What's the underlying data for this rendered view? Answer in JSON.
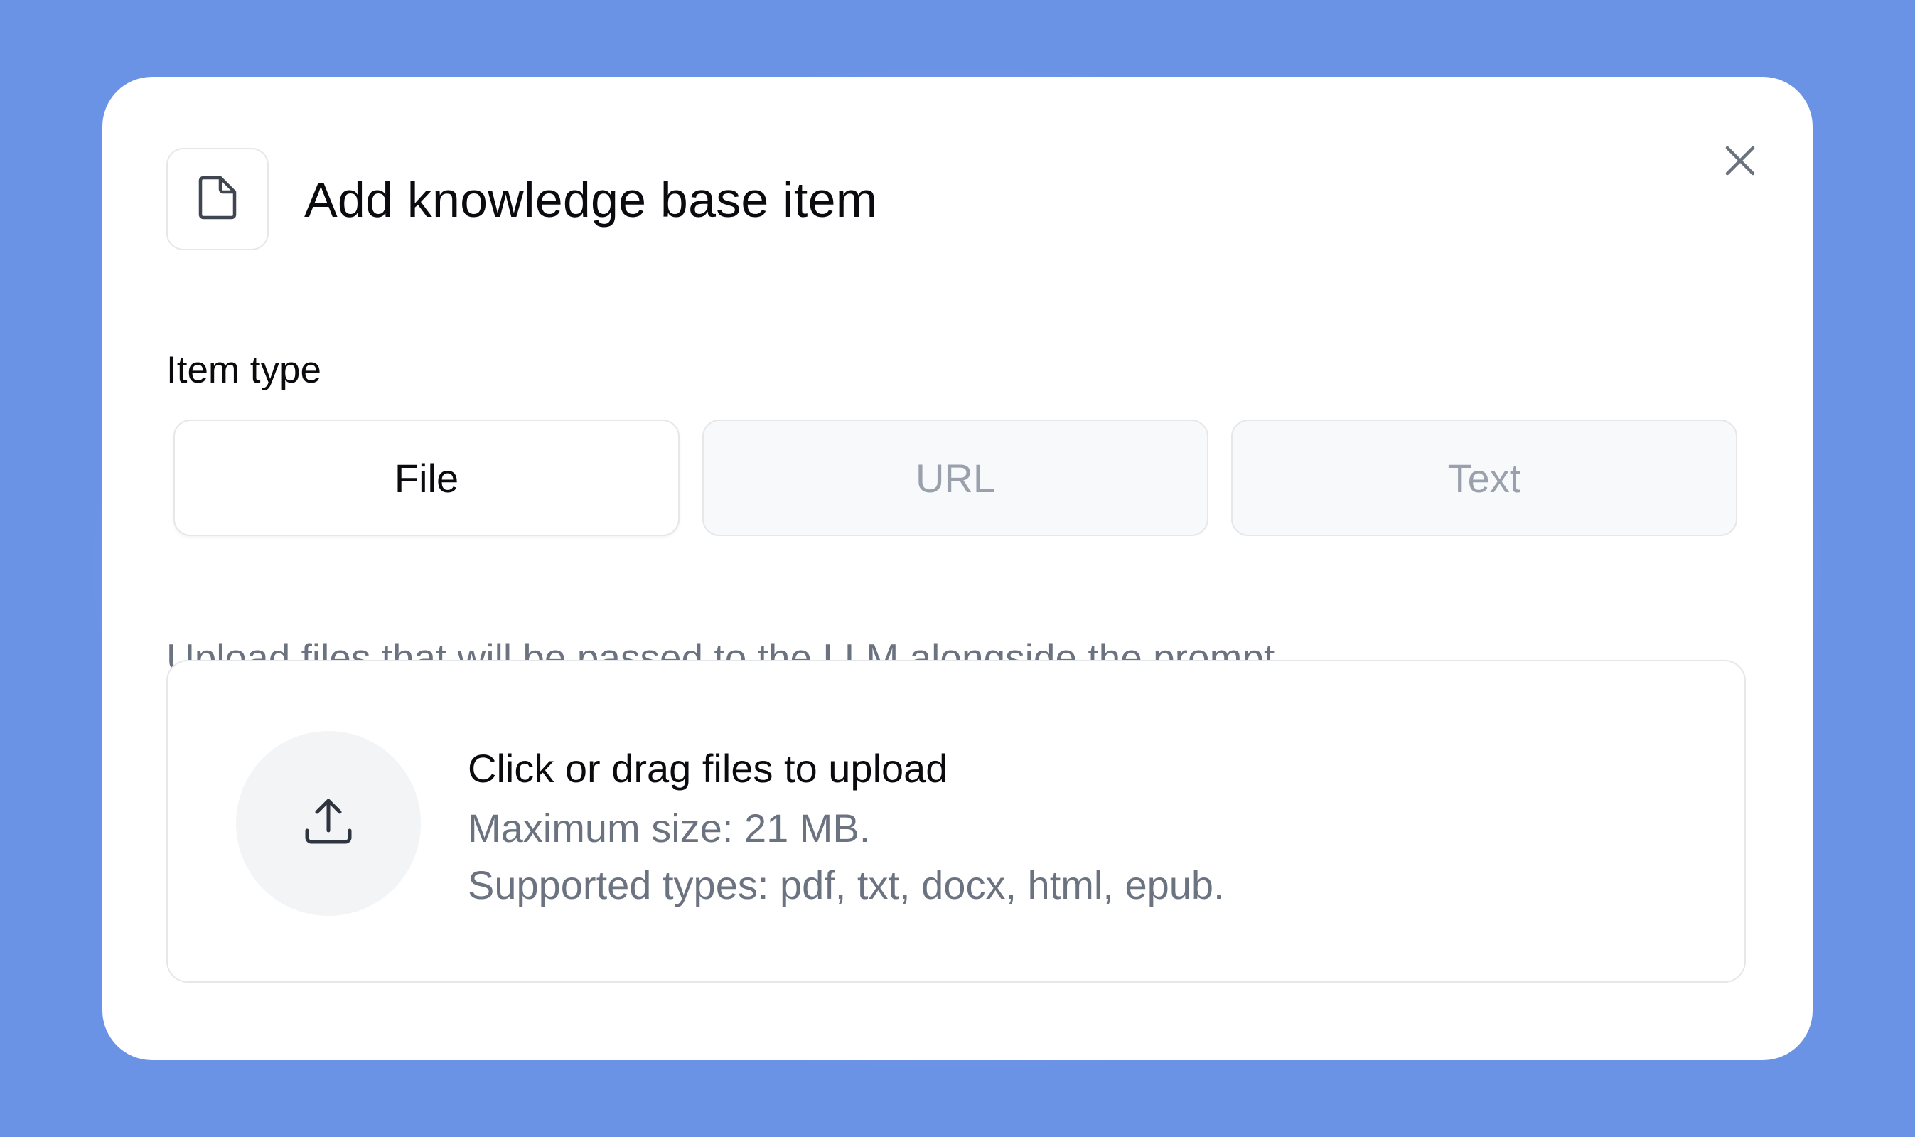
{
  "dialog": {
    "title": "Add knowledge base item",
    "header_icon": "file-icon",
    "close_icon": "close-icon"
  },
  "item_type": {
    "label": "Item type",
    "options": [
      {
        "label": "File",
        "selected": true
      },
      {
        "label": "URL",
        "selected": false
      },
      {
        "label": "Text",
        "selected": false
      }
    ],
    "helper_text": "Upload files that will be passed to the LLM alongside the prompt."
  },
  "upload": {
    "icon": "upload-icon",
    "title": "Click or drag files to upload",
    "max_size": "Maximum size: 21 MB.",
    "supported_types": "Supported types: pdf, txt, docx, html, epub."
  },
  "colors": {
    "background": "#6a93e6",
    "glow": "#c8a0e4",
    "modal": "#ffffff",
    "text_primary": "#0b0b0f",
    "text_muted": "#6b7280",
    "text_disabled": "#9aa1ad",
    "border": "#e5e7eb",
    "upload_circle": "#f3f4f6"
  }
}
